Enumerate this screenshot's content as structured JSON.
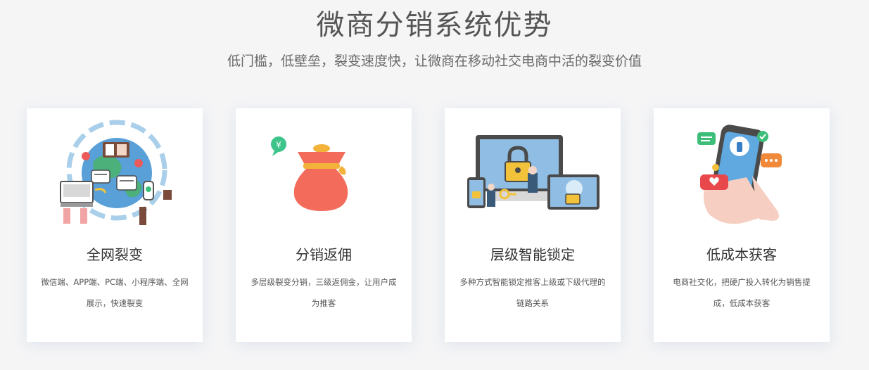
{
  "header": {
    "title": "微商分销系统优势",
    "subtitle": "低门槛，低壁垒，裂变速度快，让微商在移动社交电商中活的裂变价值"
  },
  "cards": [
    {
      "title": "全网裂变",
      "description": "微信端、APP端、PC端、小程序端、全网展示，快速裂变",
      "icon": "globe-network-icon"
    },
    {
      "title": "分销返佣",
      "description": "多层级裂变分销，三级返佣金，让用户成为推客",
      "icon": "money-bag-icon",
      "badge": "¥"
    },
    {
      "title": "层级智能锁定",
      "description": "多种方式智能锁定推客上级或下级代理的链路关系",
      "icon": "devices-lock-icon"
    },
    {
      "title": "低成本获客",
      "description": "电商社交化，把硬广投入转化为销售提成，低成本获客",
      "icon": "phone-social-icon"
    }
  ],
  "colors": {
    "background": "#f5f5f6",
    "card": "#ffffff",
    "title": "#555555",
    "bag": "#f26b5b",
    "accent_blue": "#6aa6d8",
    "accent_green": "#3dbf7a"
  }
}
